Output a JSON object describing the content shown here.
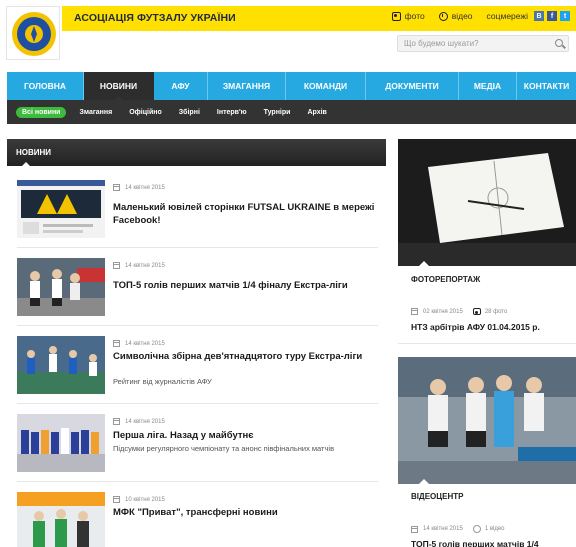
{
  "header": {
    "site_name": "АСОЦІАЦІЯ ФУТЗАЛУ УКРАЇНИ",
    "links": {
      "photo": "фото",
      "video": "відео",
      "social": "соцмережі"
    },
    "social_icons": [
      "vk-icon",
      "facebook-icon",
      "twitter-icon"
    ],
    "search_placeholder": "Що будемо шукати?",
    "colors": {
      "brand_yellow": "#ffe000",
      "nav_blue": "#25a9e0",
      "dark": "#2d2d2d",
      "accent_green": "#3dbb3d"
    }
  },
  "nav": {
    "items": [
      "ГОЛОВНА",
      "НОВИНИ",
      "АФУ",
      "ЗМАГАННЯ",
      "КОМАНДИ",
      "ДОКУМЕНТИ",
      "МЕДІА",
      "КОНТАКТИ"
    ],
    "active": "НОВИНИ"
  },
  "subnav": {
    "items": [
      "Всі новини",
      "Змагання",
      "Офіційно",
      "Збірні",
      "Інтерв'ю",
      "Турніри",
      "Архів"
    ],
    "active": "Всі новини"
  },
  "news": {
    "heading": "НОВИНИ",
    "items": [
      {
        "date": "14 квітня 2015",
        "title": "Маленький ювілей сторінки FUTSAL UKRAINE в мережі Facebook!",
        "subtitle": ""
      },
      {
        "date": "14 квітня 2015",
        "title": "ТОП-5 голів перших матчів 1/4 фіналу Екстра-ліги",
        "subtitle": ""
      },
      {
        "date": "14 квітня 2015",
        "title": "Символічна збірна дев'ятнадцятого туру Екстра-ліги",
        "subtitle": "Рейтинг від журналістів АФУ"
      },
      {
        "date": "14 квітня 2015",
        "title": "Перша ліга. Назад у майбутнє",
        "subtitle": "Підсумки регулярного чемпіонату та анонс півфінальних матчів"
      },
      {
        "date": "10 квітня 2015",
        "title": "МФК \"Приват\", трансферні новини",
        "subtitle": ""
      }
    ]
  },
  "photoreport": {
    "label": "ФОТОРЕПОРТАЖ",
    "date": "02 квітня 2015",
    "count": "28 фото",
    "title": "НТЗ арбітрів АФУ 01.04.2015 р."
  },
  "videocenter": {
    "label": "ВІДЕОЦЕНТР",
    "date": "14 квітня 2015",
    "count": "1 відео",
    "title": "ТОП-5 голів перших матчів 1/4"
  }
}
